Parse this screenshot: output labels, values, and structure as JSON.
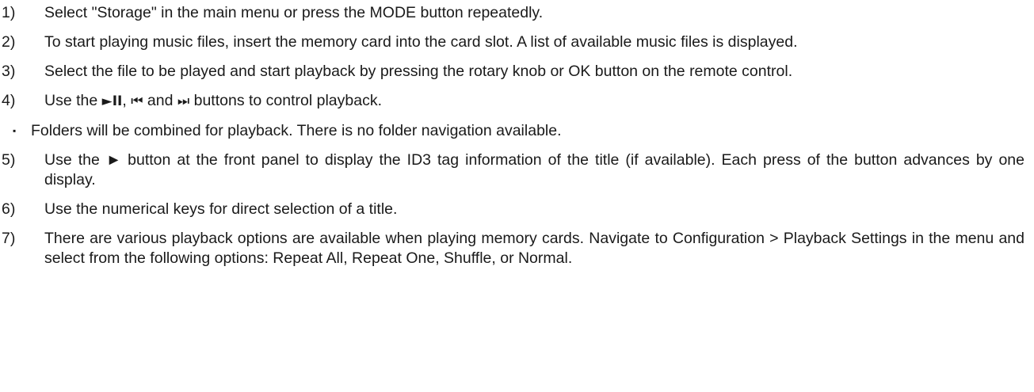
{
  "steps": [
    {
      "number": "1)",
      "text": "Select \"Storage\" in the main menu or press the MODE button repeatedly."
    },
    {
      "number": "2)",
      "text": "To start playing music files, insert the memory card into the card slot. A list of available music files is displayed."
    },
    {
      "number": "3)",
      "text": "Select the file to be played and start playback by pressing the rotary knob or OK button on the remote control."
    },
    {
      "number": "4)",
      "text_before": "Use the ",
      "play_pause_symbol": "►II",
      "text_sep1": ", ",
      "prev_symbol": "⏮",
      "text_sep2": " and ",
      "next_symbol": "⏭",
      "text_after": " buttons to control playback."
    },
    {
      "bullet": "▪",
      "text": "Folders will be combined for playback. There is no folder navigation available."
    },
    {
      "number": "5)",
      "text": "Use the ► button at the front panel to display the ID3 tag information of the title (if available). Each press of the button advances by one display."
    },
    {
      "number": "6)",
      "text": "Use the numerical keys for direct selection of a title."
    },
    {
      "number": "7)",
      "text": "There are various playback options are available when playing memory cards. Navigate to Configuration > Playback Settings in the menu and select from the following options: Repeat All, Repeat One, Shuffle, or Normal."
    }
  ]
}
